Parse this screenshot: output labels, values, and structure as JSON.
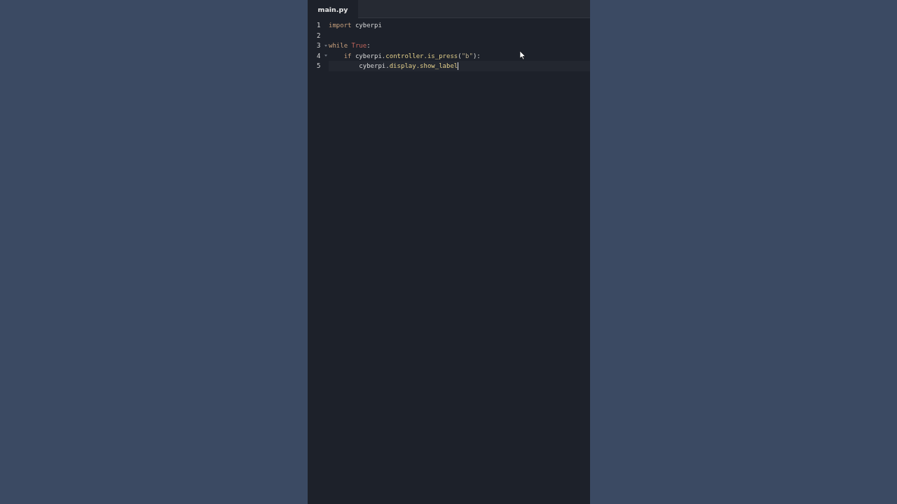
{
  "tabs": [
    {
      "label": "main.py",
      "selected": true
    }
  ],
  "lines": [
    {
      "number": "1",
      "foldable": false,
      "current": false,
      "tokens": [
        {
          "kind": "keyword",
          "text": "import"
        },
        {
          "kind": "plain",
          "text": " cyberpi"
        }
      ]
    },
    {
      "number": "2",
      "foldable": false,
      "current": false
    },
    {
      "number": "3",
      "foldable": true,
      "current": false,
      "tokens": [
        {
          "kind": "keyword",
          "text": "while "
        },
        {
          "kind": "constant",
          "text": "True"
        },
        {
          "kind": "plain",
          "text": ":"
        }
      ]
    },
    {
      "number": "4",
      "foldable": true,
      "current": false,
      "tokens": [
        {
          "kind": "keyword",
          "text": "    if"
        },
        {
          "kind": "plain",
          "text": " cyberpi."
        },
        {
          "kind": "method",
          "text": "controller.is_press"
        },
        {
          "kind": "plain",
          "text": "("
        },
        {
          "kind": "string",
          "text": "\"b\""
        },
        {
          "kind": "plain",
          "text": "):"
        }
      ]
    },
    {
      "number": "5",
      "foldable": false,
      "current": true,
      "tokens": [
        {
          "kind": "plain",
          "text": "        cyberpi."
        },
        {
          "kind": "method",
          "text": "display.show_label"
        }
      ]
    }
  ]
}
